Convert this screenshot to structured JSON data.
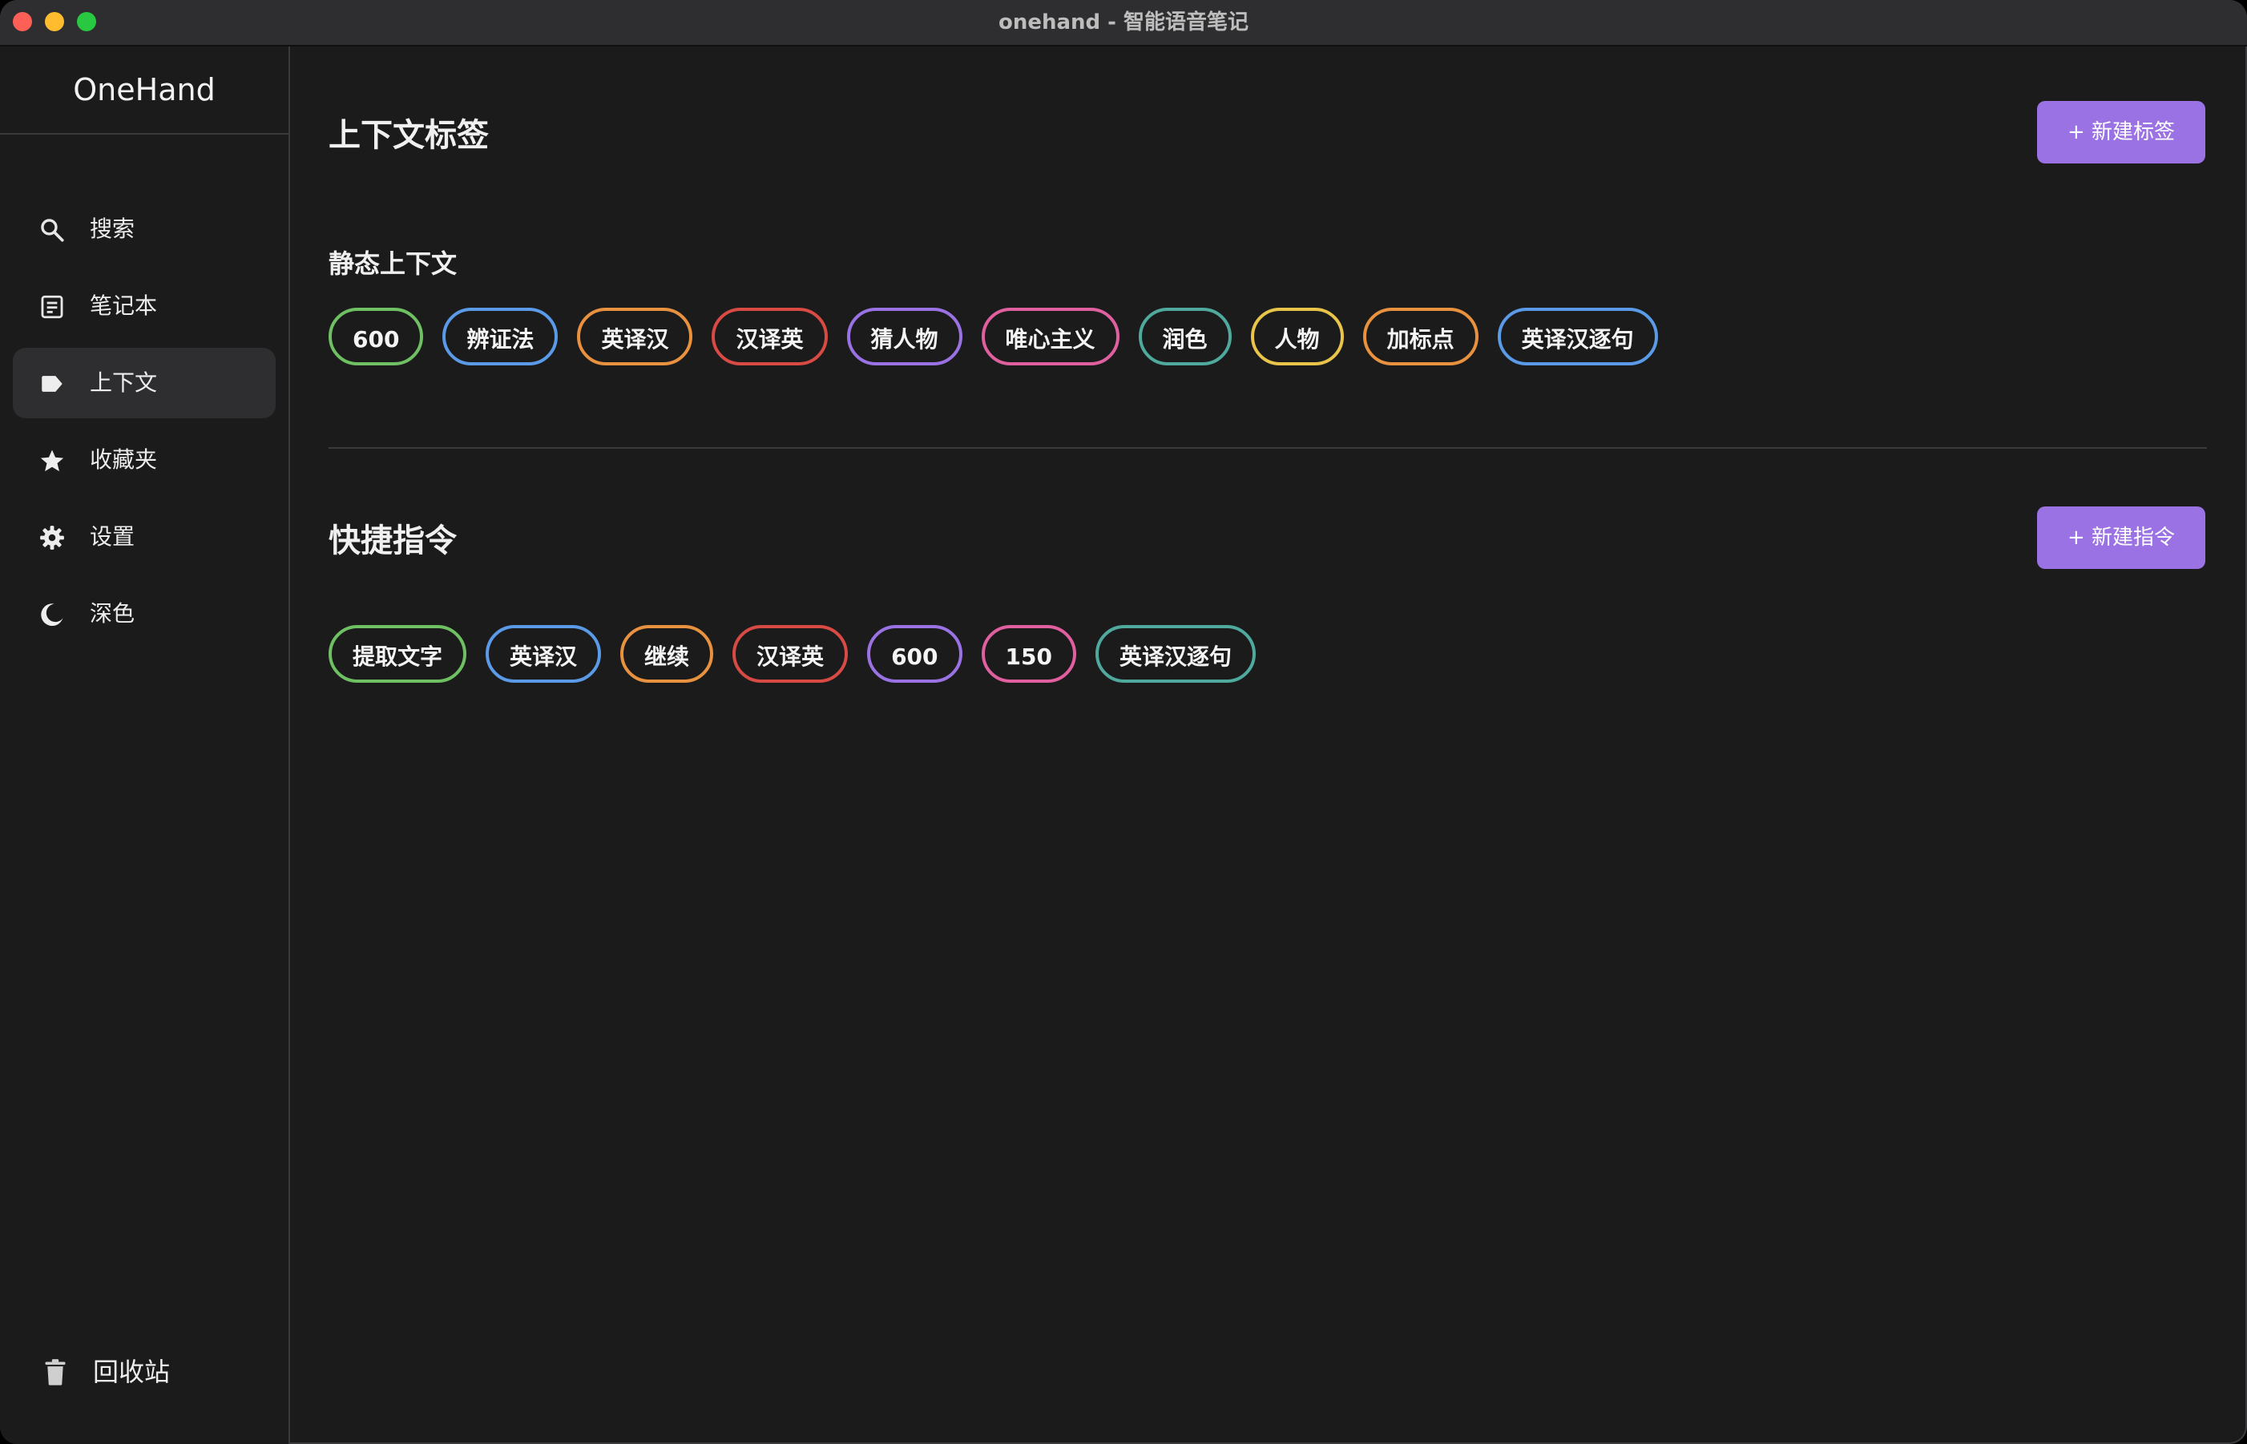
{
  "window": {
    "title": "onehand - 智能语音笔记"
  },
  "sidebar": {
    "brand": "OneHand",
    "items": [
      {
        "label": "搜索",
        "icon": "search-icon",
        "active": false
      },
      {
        "label": "笔记本",
        "icon": "notebook-icon",
        "active": false
      },
      {
        "label": "上下文",
        "icon": "tag-icon",
        "active": true
      },
      {
        "label": "收藏夹",
        "icon": "star-icon",
        "active": false
      },
      {
        "label": "设置",
        "icon": "gear-icon",
        "active": false
      },
      {
        "label": "深色",
        "icon": "moon-icon",
        "active": false
      }
    ],
    "trash": {
      "label": "回收站",
      "icon": "trash-icon"
    }
  },
  "main": {
    "title": "上下文标签",
    "new_tag_button": "+ 新建标签",
    "static_section": {
      "title": "静态上下文",
      "chips": [
        {
          "label": "600",
          "color": "#6fbf63"
        },
        {
          "label": "辨证法",
          "color": "#5a9ae6"
        },
        {
          "label": "英译汉",
          "color": "#e8913f"
        },
        {
          "label": "汉译英",
          "color": "#d84a44"
        },
        {
          "label": "猜人物",
          "color": "#9a72e4"
        },
        {
          "label": "唯心主义",
          "color": "#e0609f"
        },
        {
          "label": "润色",
          "color": "#4fa99d"
        },
        {
          "label": "人物",
          "color": "#e9c44a"
        },
        {
          "label": "加标点",
          "color": "#e8913f"
        },
        {
          "label": "英译汉逐句",
          "color": "#5a9ae6"
        }
      ]
    },
    "commands_section": {
      "title": "快捷指令",
      "new_command_button": "+ 新建指令",
      "chips": [
        {
          "label": "提取文字",
          "color": "#6fbf63"
        },
        {
          "label": "英译汉",
          "color": "#5a9ae6"
        },
        {
          "label": "继续",
          "color": "#e8913f"
        },
        {
          "label": "汉译英",
          "color": "#d84a44"
        },
        {
          "label": "600",
          "color": "#9a72e4"
        },
        {
          "label": "150",
          "color": "#e0609f"
        },
        {
          "label": "英译汉逐句",
          "color": "#4fa99d"
        }
      ]
    }
  }
}
